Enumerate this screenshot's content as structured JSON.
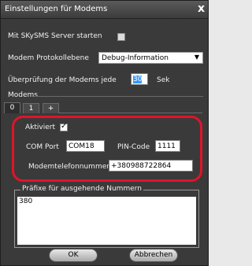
{
  "window": {
    "title": "Einstellungen für Modems",
    "close_glyph": "x"
  },
  "start_server": {
    "label": "Mit SKySMS Server starten",
    "checked": false
  },
  "protocol": {
    "label": "Modem Protokollebene",
    "selected": "Debug-Information"
  },
  "check_interval": {
    "label": "Überprüfung der Modems jede",
    "value": "30",
    "unit": "Sek"
  },
  "modems": {
    "group_label": "Modems",
    "tabs": [
      {
        "label": "0"
      },
      {
        "label": "1"
      },
      {
        "label": "+"
      }
    ],
    "active_tab": "0",
    "activated": {
      "label": "Aktiviert",
      "checked": true
    },
    "com_port": {
      "label": "COM Port",
      "value": "COM18"
    },
    "pin": {
      "label": "PIN-Code",
      "value": "1111"
    },
    "phone": {
      "label": "Modemtelefonnummer",
      "value": "+380988722864"
    }
  },
  "prefixes": {
    "legend": "Präfixe für ausgehende Nummern",
    "value": "380"
  },
  "buttons": {
    "ok": "OK",
    "cancel": "Abbrechen"
  },
  "colors": {
    "highlight_ring": "#e0142a",
    "selection": "#3399ff"
  }
}
